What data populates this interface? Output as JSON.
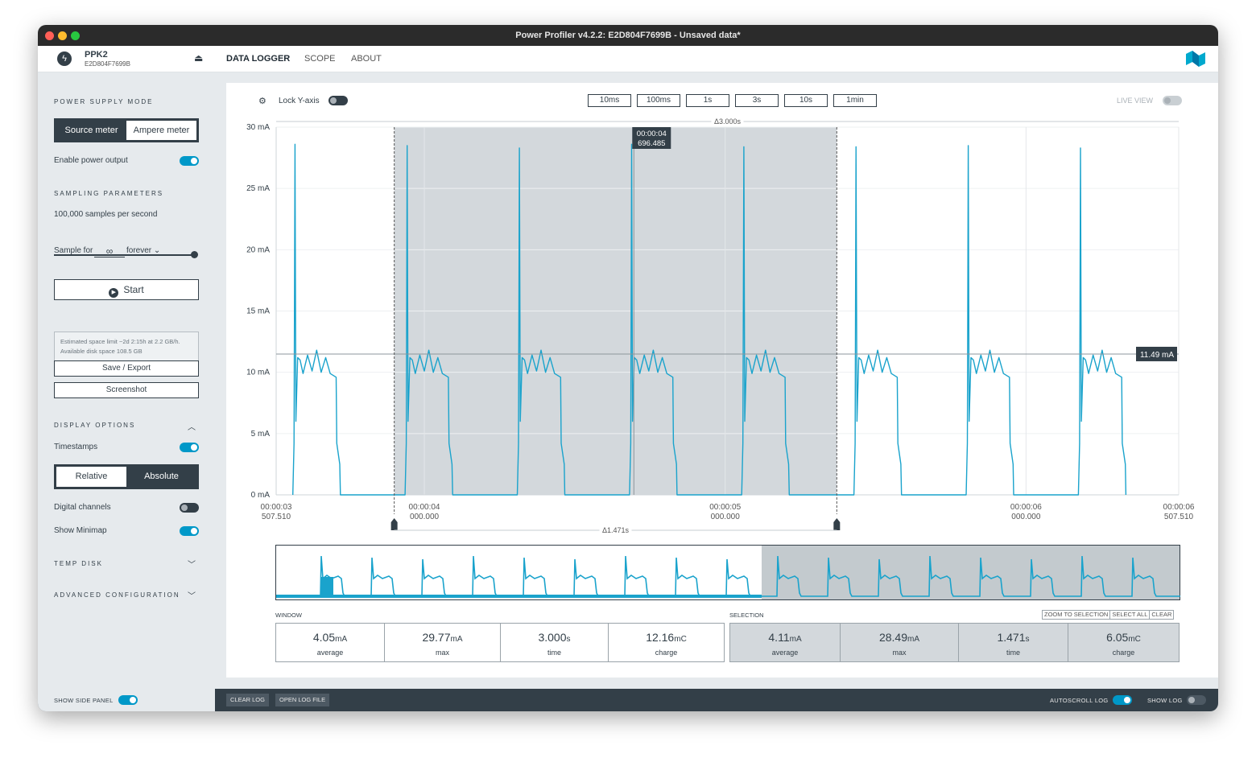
{
  "window": {
    "title": "Power Profiler v4.2.2: E2D804F7699B - Unsaved data*"
  },
  "device": {
    "name": "PPK2",
    "serial": "E2D804F7699B"
  },
  "nav": {
    "tabs": [
      "DATA LOGGER",
      "SCOPE",
      "ABOUT"
    ],
    "active": "DATA LOGGER"
  },
  "sidebar": {
    "power_supply_mode": "POWER SUPPLY MODE",
    "mode_source": "Source meter",
    "mode_ampere": "Ampere meter",
    "enable_power_output": "Enable power output",
    "sampling_parameters": "SAMPLING PARAMETERS",
    "sample_rate": "100,000 samples per second",
    "sample_for_label": "Sample for",
    "sample_for_value": "∞",
    "sample_for_unit": "forever",
    "start": "Start",
    "space_note": "Estimated space limit ~2d 2:15h at 2.2 GB/h. Available disk space 108.5 GB",
    "save_export": "Save / Export",
    "screenshot": "Screenshot",
    "display_options": "DISPLAY OPTIONS",
    "timestamps": "Timestamps",
    "relative": "Relative",
    "absolute": "Absolute",
    "digital_channels": "Digital channels",
    "show_minimap": "Show Minimap",
    "temp_disk": "TEMP DISK",
    "advanced_configuration": "ADVANCED CONFIGURATION"
  },
  "chart_toolbar": {
    "lock_y_axis": "Lock Y-axis",
    "ranges": [
      "10ms",
      "100ms",
      "1s",
      "3s",
      "10s",
      "1min"
    ],
    "live_view": "LIVE VIEW"
  },
  "chart_data": {
    "type": "line",
    "title": "",
    "ylabel": "",
    "ylim": [
      0,
      30
    ],
    "y_unit": "mA",
    "yticks": [
      "30 mA",
      "25 mA",
      "20 mA",
      "15 mA",
      "10 mA",
      "5 mA",
      "0 mA"
    ],
    "xlim_s": [
      3.50751,
      6.50751
    ],
    "xticks": [
      {
        "line1": "00:00:03",
        "line2": "507.510"
      },
      {
        "line1": "00:00:04",
        "line2": "000.000"
      },
      {
        "line1": "00:00:05",
        "line2": "000.000"
      },
      {
        "line1": "00:00:06",
        "line2": "000.000"
      },
      {
        "line1": "00:00:06",
        "line2": "507.510"
      }
    ],
    "window_delta": "Δ3.000s",
    "selection_delta": "Δ1.471s",
    "selection_range_s": [
      3.9,
      5.371
    ],
    "cursor_label_time": "00:00:04",
    "cursor_label_value": "696.485",
    "cursor_time_s": 4.6965,
    "hline_value_mA": 11.49,
    "hline_label": "11.49 mA",
    "series": [
      {
        "period_s": 0.373,
        "first_rise_s": 3.567,
        "spike_peaks_mA": [
          28.6,
          28.5,
          28.3,
          28.6,
          28.4,
          28.4,
          28.5,
          28.3,
          28.2
        ],
        "plateau_mA": 9.6,
        "plateau_duration_s": 0.14,
        "edge_level_mA": 4.2,
        "baseline_mA": 0,
        "color": "#1aa3cc"
      }
    ]
  },
  "minimap": {
    "color": "#1aa3cc"
  },
  "window_stats": {
    "label": "WINDOW",
    "average": {
      "value": "4.05",
      "unit": "mA",
      "label": "average"
    },
    "max": {
      "value": "29.77",
      "unit": "mA",
      "label": "max"
    },
    "time": {
      "value": "3.000",
      "unit": "s",
      "label": "time"
    },
    "charge": {
      "value": "12.16",
      "unit": "mC",
      "label": "charge"
    }
  },
  "selection_stats": {
    "label": "SELECTION",
    "zoom": "ZOOM TO SELECTION",
    "select_all": "SELECT ALL",
    "clear": "CLEAR",
    "average": {
      "value": "4.11",
      "unit": "mA",
      "label": "average"
    },
    "max": {
      "value": "28.49",
      "unit": "mA",
      "label": "max"
    },
    "time": {
      "value": "1.471",
      "unit": "s",
      "label": "time"
    },
    "charge": {
      "value": "6.05",
      "unit": "mC",
      "label": "charge"
    }
  },
  "bottom": {
    "show_side_panel": "SHOW SIDE PANEL",
    "clear_log": "CLEAR LOG",
    "open_log_file": "OPEN LOG FILE",
    "autoscroll_log": "AUTOSCROLL LOG",
    "show_log": "SHOW LOG"
  },
  "colors": {
    "accent": "#0098c8",
    "dark": "#333f48",
    "trace": "#1aa3cc",
    "selection": "#d3d8dc"
  }
}
